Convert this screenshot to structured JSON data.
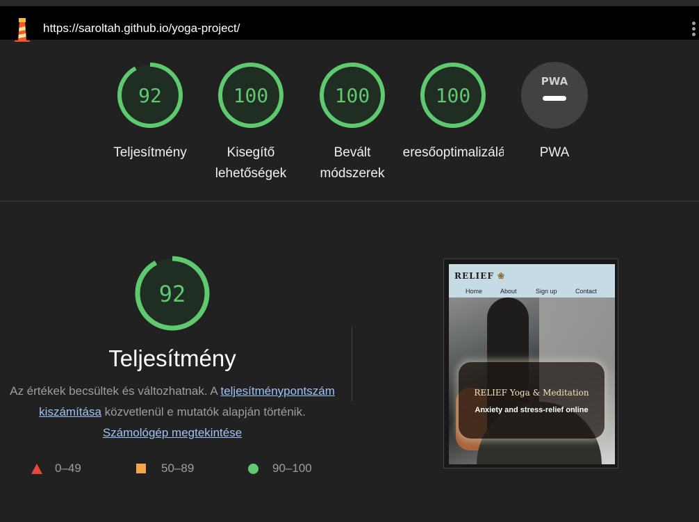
{
  "browser": {
    "url": "https://saroltah.github.io/yoga-project/",
    "logo_icon": "lighthouse-icon",
    "menu_icon": "kebab-menu-icon"
  },
  "gauges": [
    {
      "score": "92",
      "value": 92,
      "label_lines": [
        "Teljesítmény"
      ]
    },
    {
      "score": "100",
      "value": 100,
      "label_lines": [
        "Kisegítő",
        "lehetőségek"
      ]
    },
    {
      "score": "100",
      "value": 100,
      "label_lines": [
        "Bevált",
        "módszerek"
      ]
    },
    {
      "score": "100",
      "value": 100,
      "label_lines": [
        "Keresőoptimalizálás"
      ]
    },
    {
      "score": "PWA",
      "value": null,
      "label_lines": [
        "PWA"
      ]
    }
  ],
  "performance": {
    "score": "92",
    "title": "Teljesítmény",
    "desc_1": "Az értékek becsültek és változhatnak. A ",
    "link_1": "teljesítménypontszám kiszámítása",
    "desc_2": " közvetlenül e mutatók alapján történik. ",
    "link_2": "Számológép megtekintése"
  },
  "legend": [
    {
      "icon": "red-triangle-icon",
      "range": "0–49"
    },
    {
      "icon": "orange-square-icon",
      "range": "50–89"
    },
    {
      "icon": "green-circle-icon",
      "range": "90–100"
    }
  ],
  "screenshot": {
    "logo": "RELIEF",
    "nav": [
      "Home",
      "About",
      "Sign up",
      "Contact"
    ],
    "headline": "RELIEF Yoga & Meditation",
    "subline": "Anxiety and stress-relief online"
  },
  "colors": {
    "pass": "#5ec96f",
    "average": "#f0a64b",
    "fail": "#e7463b",
    "link": "#9ec3f7"
  }
}
